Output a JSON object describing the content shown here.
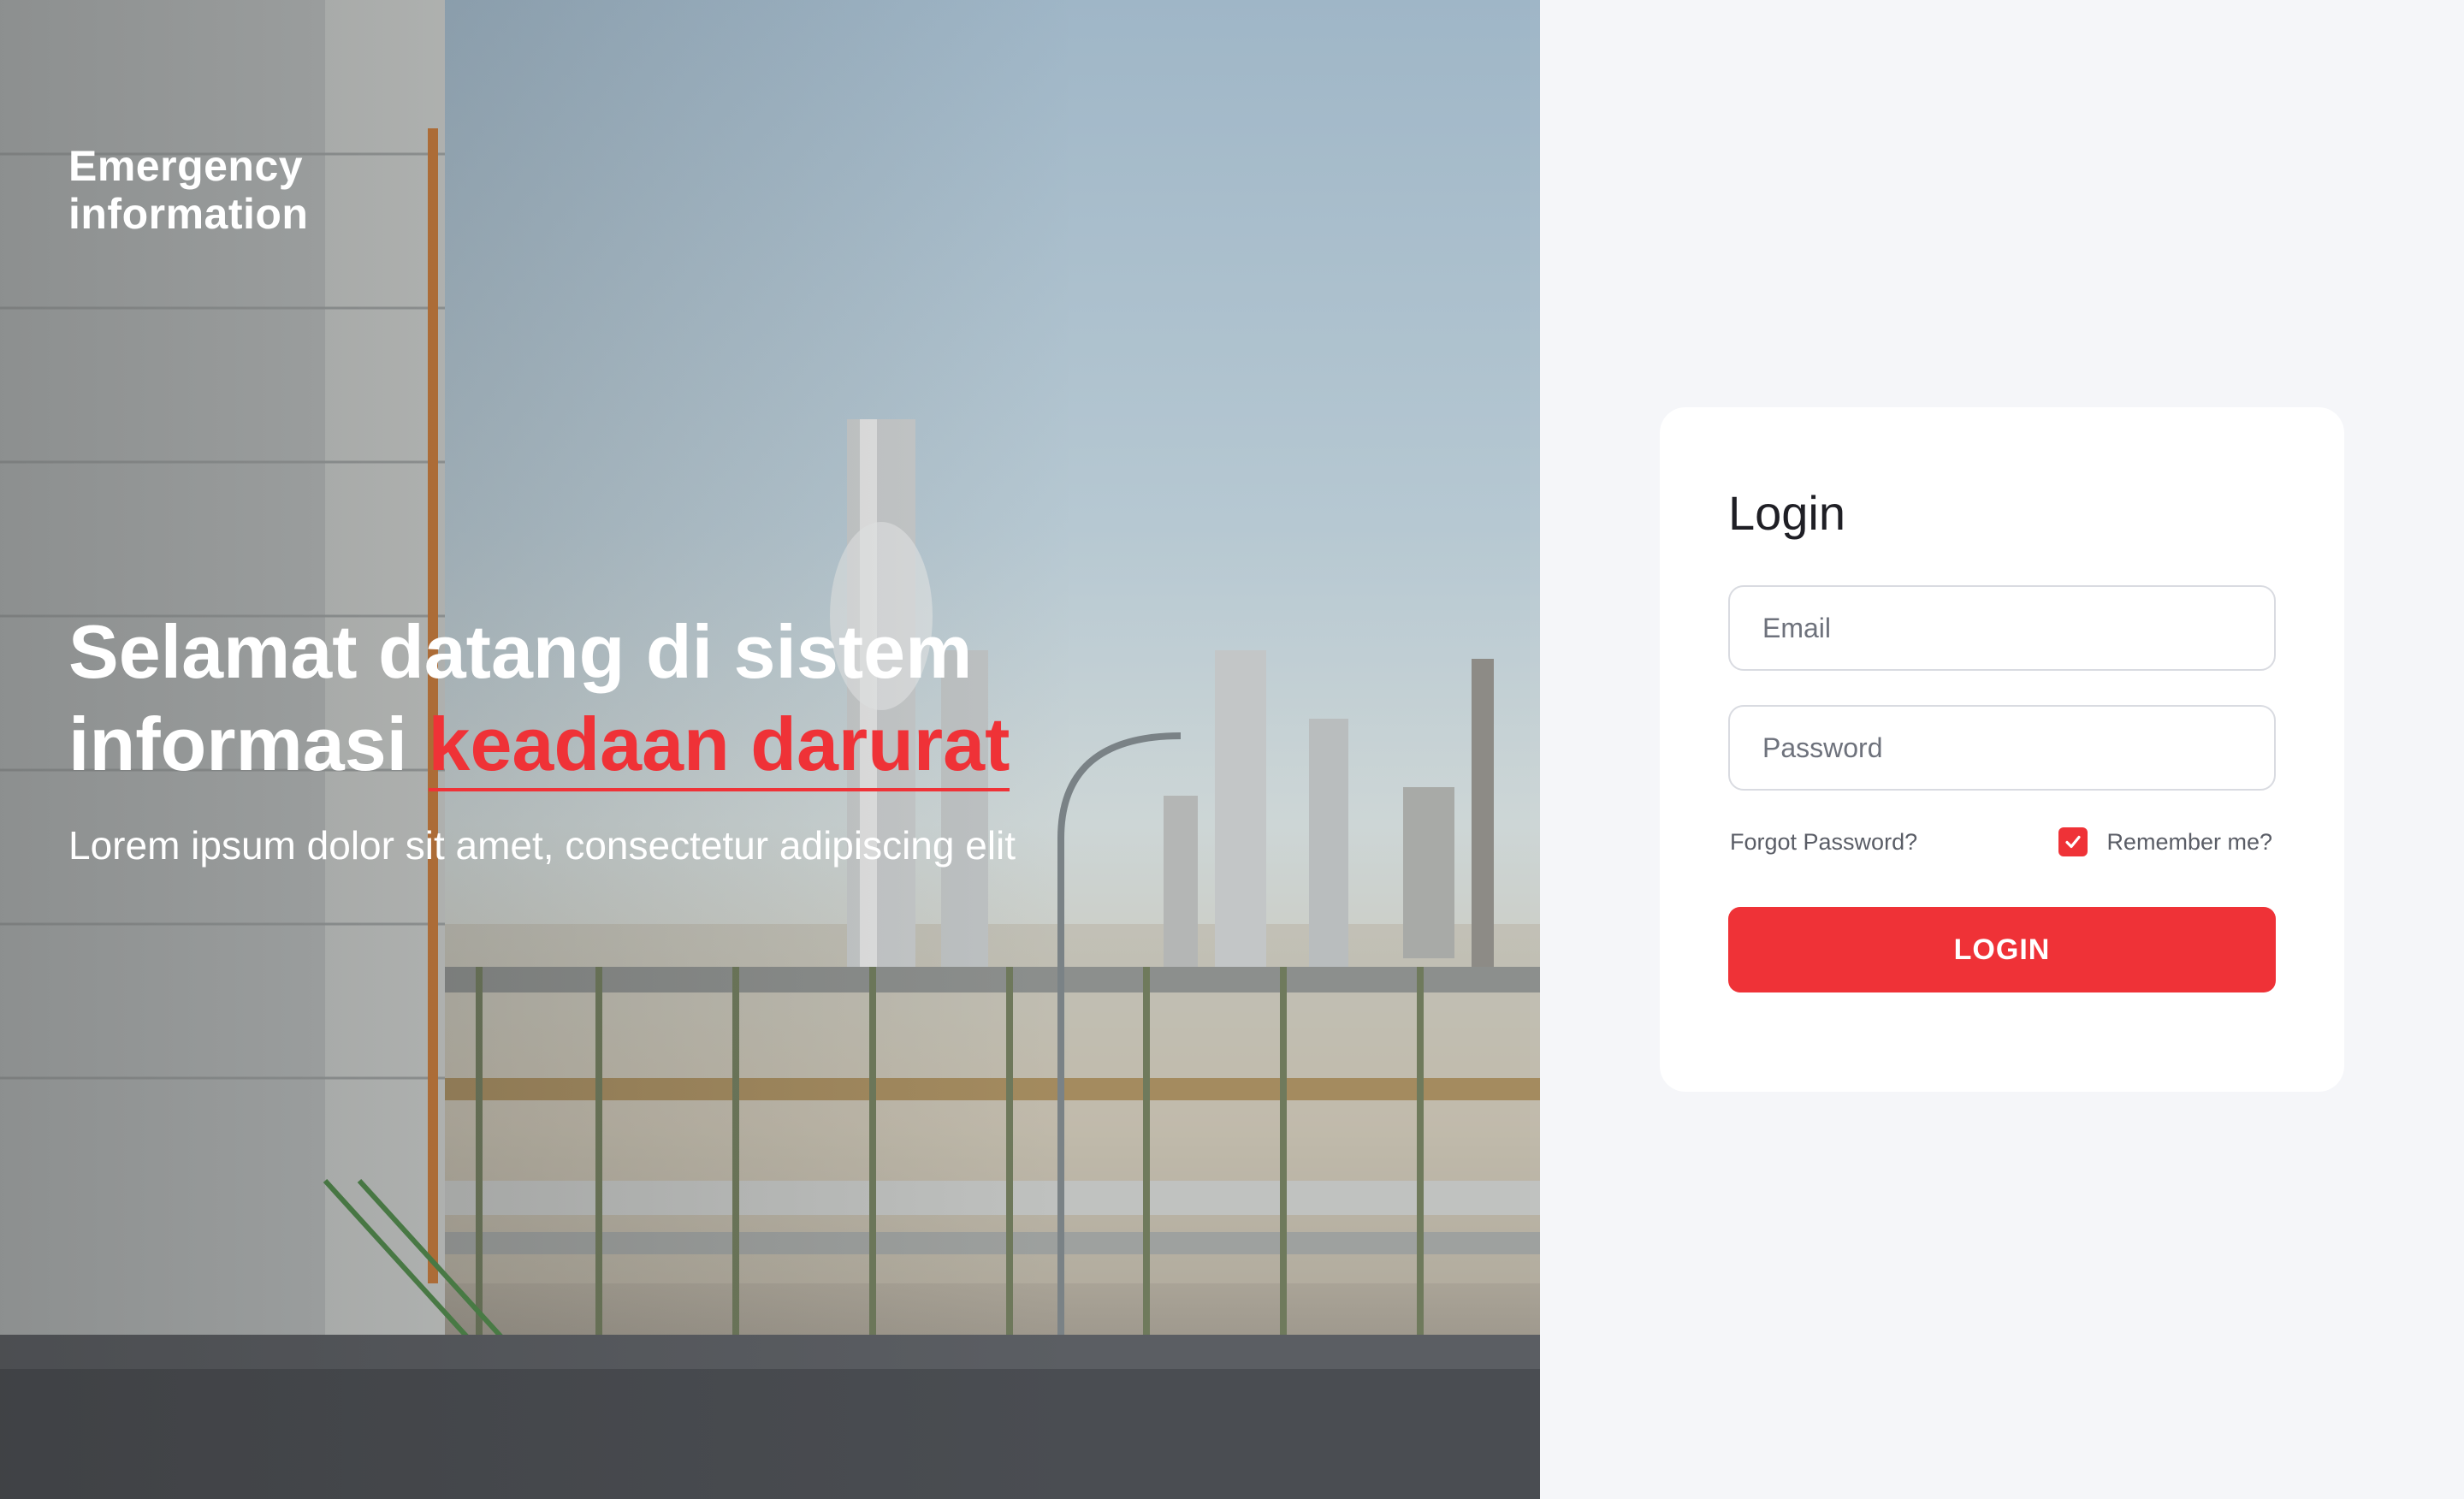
{
  "hero": {
    "brand_line1": "Emergency",
    "brand_line2": "information",
    "headline_line1": "Selamat datang di sistem",
    "headline_line2_prefix": "informasi ",
    "headline_line2_accent": "keadaan darurat",
    "subtitle": "Lorem ipsum dolor sit amet, consectetur adipiscing elit"
  },
  "login": {
    "title": "Login",
    "email_placeholder": "Email",
    "email_value": "",
    "password_placeholder": "Password",
    "password_value": "",
    "forgot_label": "Forgot Password?",
    "remember_label": "Remember me?",
    "remember_checked": true,
    "button_label": "LOGIN"
  },
  "colors": {
    "accent": "#ef3237",
    "panel_background": "#f5f6f9",
    "card_background": "#ffffff"
  },
  "icons": {
    "checkbox": "check-icon"
  }
}
